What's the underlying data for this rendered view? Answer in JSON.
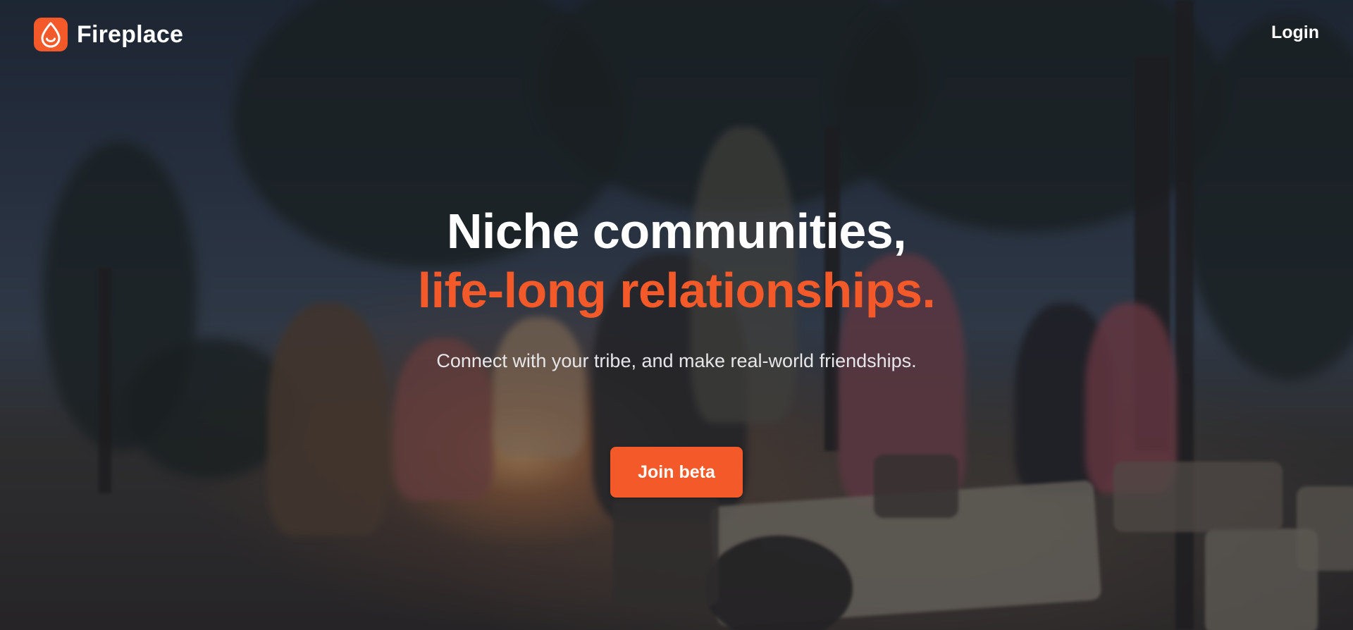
{
  "header": {
    "brand_name": "Fireplace",
    "logo_icon": "flame-drop-icon",
    "login_label": "Login"
  },
  "hero": {
    "headline_line1": "Niche communities,",
    "headline_line2": "life-long relationships.",
    "subtitle": "Connect with your tribe, and make real-world friendships.",
    "cta_label": "Join beta"
  },
  "theme": {
    "accent": "#f4592a",
    "text_primary": "#ffffff",
    "text_secondary": "#e6e6e8"
  }
}
